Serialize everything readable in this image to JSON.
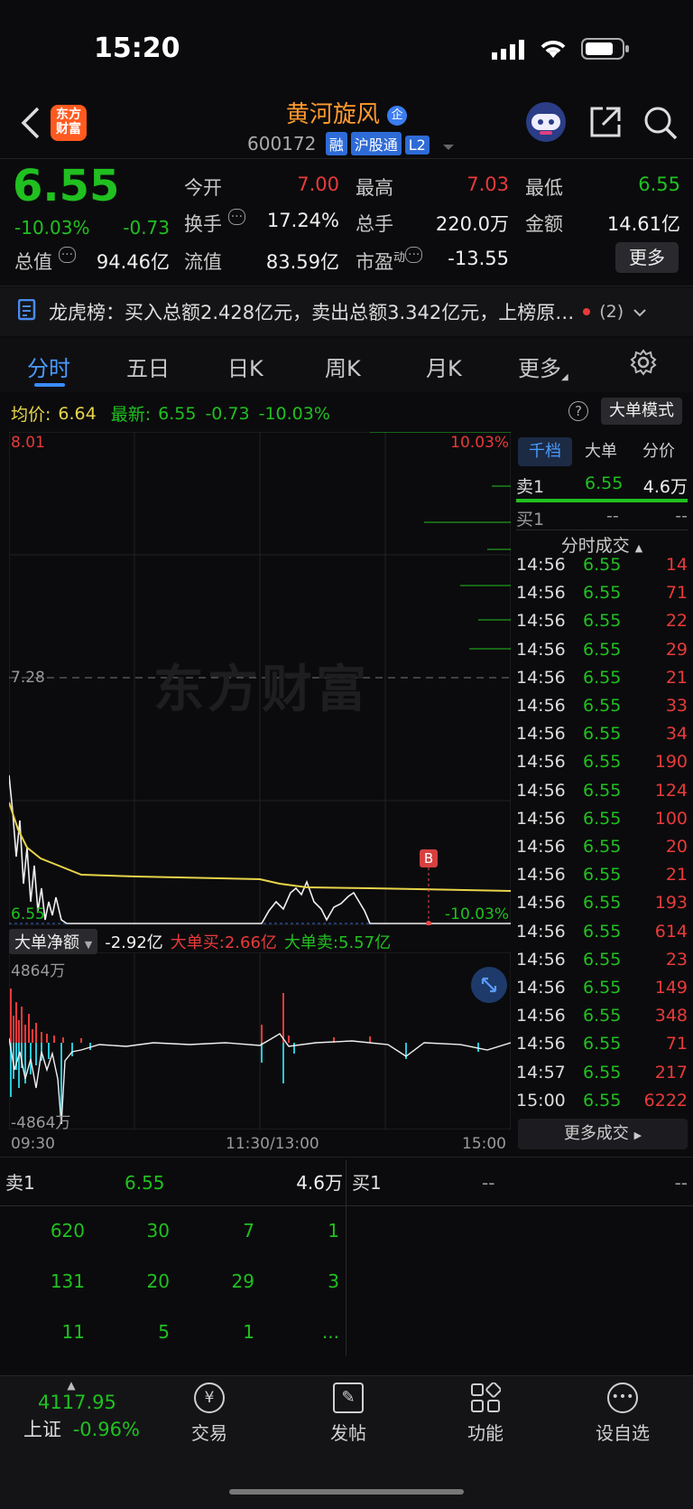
{
  "status_bar": {
    "time": "15:20"
  },
  "header": {
    "logo_text": "东方财富",
    "stock_name": "黄河旋风",
    "name_badge": "企",
    "code": "600172",
    "tags": [
      "融",
      "沪股通",
      "L2"
    ]
  },
  "quote": {
    "price": "6.55",
    "change_pct": "-10.03%",
    "change": "-0.73",
    "fields": [
      {
        "label": "今开",
        "value": "7.00"
      },
      {
        "label": "最高",
        "value": "7.03"
      },
      {
        "label": "最低",
        "value": "6.55"
      },
      {
        "label": "换手",
        "value": "17.24%"
      },
      {
        "label": "总手",
        "value": "220.0万"
      },
      {
        "label": "金额",
        "value": "14.61亿"
      },
      {
        "label": "总值",
        "value": "94.46亿"
      },
      {
        "label": "流值",
        "value": "83.59亿"
      },
      {
        "label": "市盈",
        "label_sup": "动",
        "value": "-13.55"
      }
    ],
    "more_button": "更多"
  },
  "dragon_tiger": {
    "text": "龙虎榜：买入总额2.428亿元，卖出总额3.342亿元，上榜原…",
    "count": "(2)"
  },
  "tabs": [
    "分时",
    "五日",
    "日K",
    "周K",
    "月K",
    "更多"
  ],
  "chart_info": {
    "avg_label": "均价:",
    "avg_value": "6.64",
    "latest_label": "最新:",
    "latest_value": "6.55",
    "latest_change": "-0.73",
    "latest_pct": "-10.03%",
    "big_order_mode": "大单模式"
  },
  "chart_axis": {
    "top_price": "8.01",
    "mid_price": "7.28",
    "bottom_price": "6.55",
    "top_pct": "10.03%",
    "bottom_pct": "-10.03%",
    "watermark": "东方财富",
    "marker": "B"
  },
  "flow": {
    "selector": "大单净额",
    "net_value": "-2.92亿",
    "buy_label": "大单买:2.66亿",
    "sell_label": "大单卖:5.57亿",
    "top_label": "4864万",
    "bottom_label": "-4864万"
  },
  "time_axis": [
    "09:30",
    "11:30/13:00",
    "15:00"
  ],
  "side_tabs": [
    "千档",
    "大单",
    "分价"
  ],
  "side_quote": {
    "sell_label": "卖1",
    "sell_price": "6.55",
    "sell_vol": "4.6万",
    "buy_label": "买1",
    "buy_price": "--",
    "buy_vol": "--",
    "trades_title": "分时成交"
  },
  "trades": [
    {
      "time": "14:56",
      "price": "6.55",
      "vol": "14"
    },
    {
      "time": "14:56",
      "price": "6.55",
      "vol": "71"
    },
    {
      "time": "14:56",
      "price": "6.55",
      "vol": "22"
    },
    {
      "time": "14:56",
      "price": "6.55",
      "vol": "29"
    },
    {
      "time": "14:56",
      "price": "6.55",
      "vol": "21"
    },
    {
      "time": "14:56",
      "price": "6.55",
      "vol": "33"
    },
    {
      "time": "14:56",
      "price": "6.55",
      "vol": "34"
    },
    {
      "time": "14:56",
      "price": "6.55",
      "vol": "190"
    },
    {
      "time": "14:56",
      "price": "6.55",
      "vol": "124"
    },
    {
      "time": "14:56",
      "price": "6.55",
      "vol": "100"
    },
    {
      "time": "14:56",
      "price": "6.55",
      "vol": "20"
    },
    {
      "time": "14:56",
      "price": "6.55",
      "vol": "21"
    },
    {
      "time": "14:56",
      "price": "6.55",
      "vol": "193"
    },
    {
      "time": "14:56",
      "price": "6.55",
      "vol": "614"
    },
    {
      "time": "14:56",
      "price": "6.55",
      "vol": "23"
    },
    {
      "time": "14:56",
      "price": "6.55",
      "vol": "149"
    },
    {
      "time": "14:56",
      "price": "6.55",
      "vol": "348"
    },
    {
      "time": "14:56",
      "price": "6.55",
      "vol": "71"
    },
    {
      "time": "14:57",
      "price": "6.55",
      "vol": "217"
    },
    {
      "time": "15:00",
      "price": "6.55",
      "vol": "6222"
    }
  ],
  "more_trades": "更多成交",
  "order_book": {
    "sell_label": "卖1",
    "sell_price": "6.55",
    "sell_vol": "4.6万",
    "buy_label": "买1",
    "buy_price": "--",
    "buy_vol": "--",
    "queue": [
      [
        "620",
        "30",
        "7",
        "1"
      ],
      [
        "131",
        "20",
        "29",
        "3"
      ],
      [
        "11",
        "5",
        "1",
        "..."
      ]
    ]
  },
  "bottom_nav": {
    "index_value": "4117.95",
    "index_name": "上证",
    "index_pct": "-0.96%",
    "items": [
      "交易",
      "发帖",
      "功能",
      "设自选"
    ]
  }
}
